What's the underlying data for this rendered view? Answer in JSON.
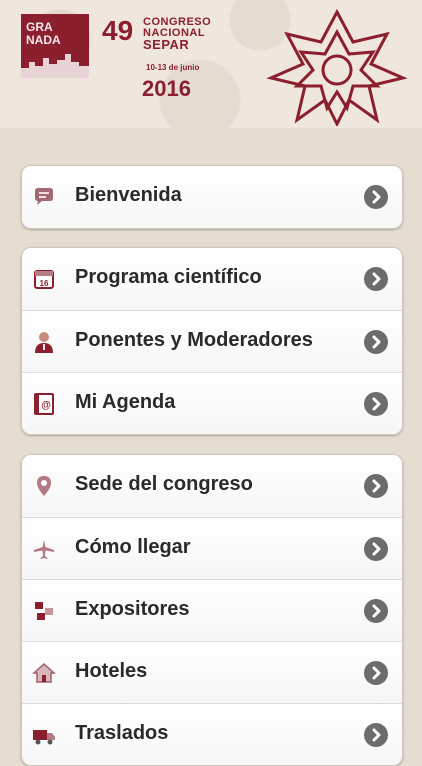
{
  "header": {
    "logo_line1": "GRA",
    "logo_line2": "NADA",
    "congress_number": "49",
    "congress_line1": "CONGRESO",
    "congress_line2": "NACIONAL",
    "congress_line3": "SEPAR",
    "dates": "10-13 de junio",
    "year": "2016"
  },
  "groups": [
    {
      "items": [
        {
          "label": "Bienvenida",
          "icon": "speech-bubble-icon"
        }
      ]
    },
    {
      "items": [
        {
          "label": "Programa científico",
          "icon": "calendar-icon"
        },
        {
          "label": "Ponentes y Moderadores",
          "icon": "person-icon"
        },
        {
          "label": "Mi Agenda",
          "icon": "address-book-icon"
        }
      ]
    },
    {
      "items": [
        {
          "label": "Sede del congreso",
          "icon": "map-pin-icon"
        },
        {
          "label": "Cómo llegar",
          "icon": "airplane-icon"
        },
        {
          "label": "Expositores",
          "icon": "exhibitor-icon"
        },
        {
          "label": "Hoteles",
          "icon": "house-icon"
        },
        {
          "label": "Traslados",
          "icon": "truck-icon"
        }
      ]
    }
  ],
  "colors": {
    "brand": "#8b1f2d",
    "background": "#e6ddd1",
    "chevron": "#6c6c6c"
  }
}
